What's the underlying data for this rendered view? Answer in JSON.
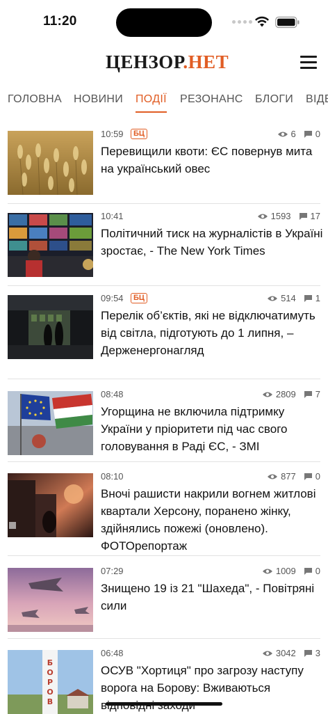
{
  "status_bar": {
    "time": "11:20",
    "icons": [
      "signal-dots-icon",
      "wifi-icon",
      "battery-icon"
    ]
  },
  "header": {
    "logo_main": "ЦЕНЗОР",
    "logo_dot": ".",
    "logo_net": "НЕТ",
    "menu_icon": "hamburger-menu-icon"
  },
  "nav": {
    "tabs": [
      {
        "label": "ГОЛОВНА",
        "active": false
      },
      {
        "label": "НОВИНИ",
        "active": false
      },
      {
        "label": "ПОДІЇ",
        "active": true
      },
      {
        "label": "РЕЗОНАНС",
        "active": false
      },
      {
        "label": "БЛОГИ",
        "active": false
      },
      {
        "label": "ВІДЕО",
        "active": false
      }
    ]
  },
  "news": {
    "items": [
      {
        "time": "10:59",
        "badge": "БЦ",
        "views": "6",
        "comments": "0",
        "title": "Перевищили квоти: ЄС повернув мита на український овес",
        "image": "oats-field"
      },
      {
        "time": "10:41",
        "badge": "",
        "views": "1593",
        "comments": "17",
        "title": "Політичний тиск на журналістів в Україні зростає, - The New York Times",
        "image": "tv-control-room"
      },
      {
        "time": "09:54",
        "badge": "БЦ",
        "views": "514",
        "comments": "1",
        "title": "Перелік об’єктів, які не відключатимуть від світла, підготують до 1 липня, – Держенергонагляд",
        "image": "dark-shop"
      },
      {
        "time": "08:48",
        "badge": "",
        "views": "2809",
        "comments": "7",
        "title": "Угорщина не включила підтримку України у пріоритети під час свого головування в Раді ЄС, - ЗМІ",
        "image": "eu-hungary-flags"
      },
      {
        "time": "08:10",
        "badge": "",
        "views": "877",
        "comments": "0",
        "title": "Вночі рашисти накрили вогнем житлові квартали Херсону, поранено жінку, здійнялись пожежі (оновлено). ФОТОрепортаж",
        "image": "fire-ruins"
      },
      {
        "time": "07:29",
        "badge": "",
        "views": "1009",
        "comments": "0",
        "title": "Знищено 19 із 21 \"Шахеда\", - Повітряні сили",
        "image": "shahed-drones"
      },
      {
        "time": "06:48",
        "badge": "",
        "views": "3042",
        "comments": "3",
        "title": "ОСУВ \"Хортиця\" про загрозу наступу ворога на Борову: Вживаються відповідні заходи",
        "image": "borova-sign"
      }
    ]
  },
  "colors": {
    "accent": "#e15d24",
    "text": "#111111",
    "muted": "#555555"
  }
}
